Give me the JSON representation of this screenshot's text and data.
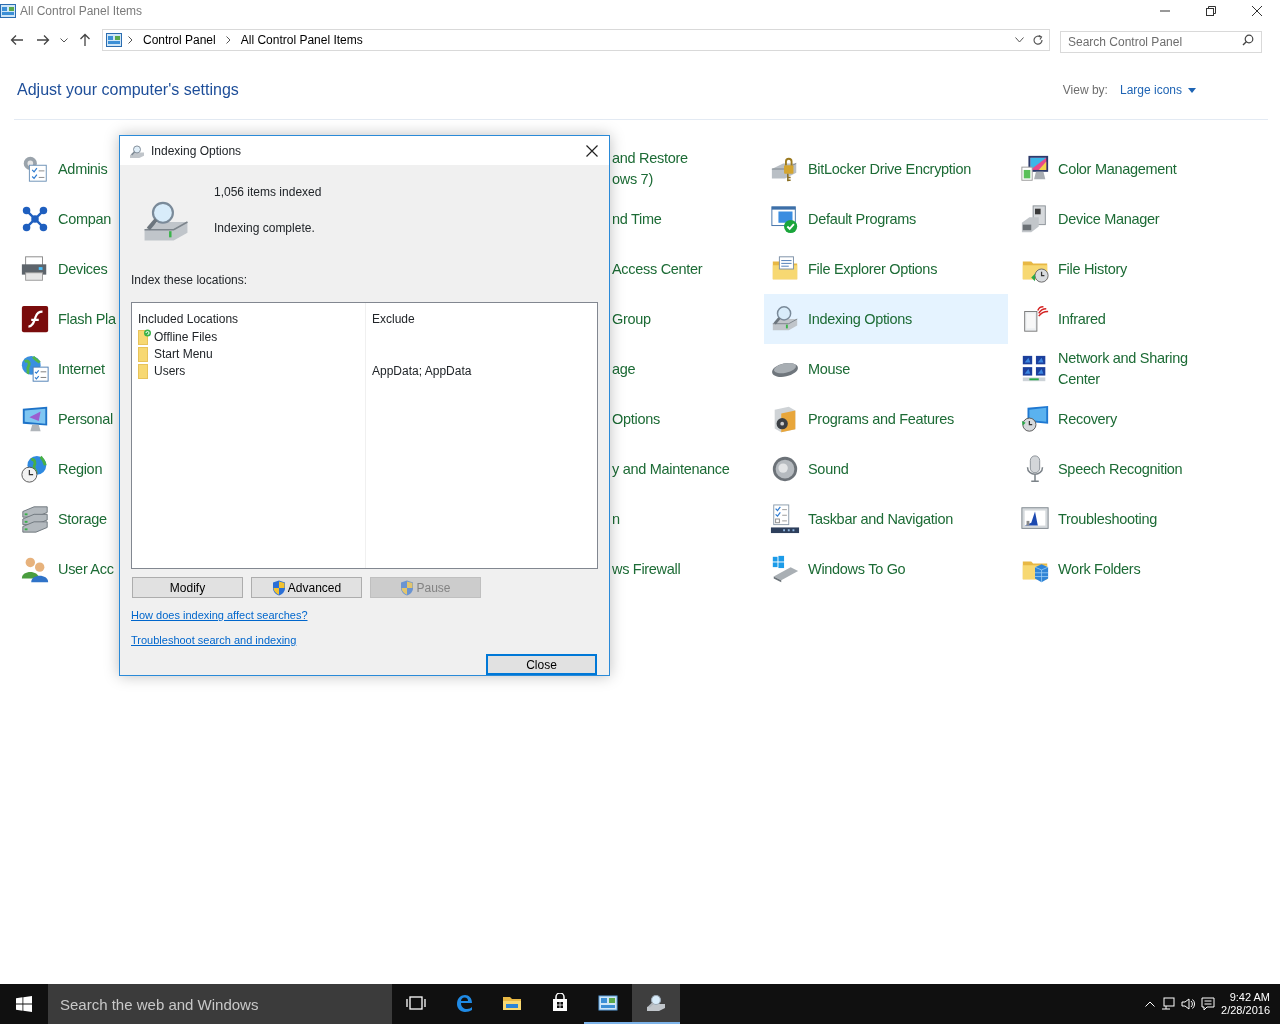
{
  "window": {
    "title": "All Control Panel Items"
  },
  "address_bar": {
    "breadcrumbs": [
      "Control Panel",
      "All Control Panel Items"
    ]
  },
  "search": {
    "placeholder": "Search Control Panel"
  },
  "heading": "Adjust your computer's settings",
  "view_by": {
    "label": "View by:",
    "value": "Large icons"
  },
  "items": [
    {
      "label": "Adminis",
      "kind": "icon",
      "selected": false
    },
    {
      "label": "Compan",
      "kind": "icon",
      "selected": false
    },
    {
      "label": "Devices",
      "kind": "icon",
      "selected": false
    },
    {
      "label": "Flash Pla",
      "kind": "icon",
      "selected": false
    },
    {
      "label": "Internet",
      "kind": "icon",
      "selected": false
    },
    {
      "label": "Personal",
      "kind": "icon",
      "selected": false
    },
    {
      "label": "Region",
      "kind": "icon",
      "selected": false
    },
    {
      "label": "Storage",
      "kind": "icon",
      "selected": false
    },
    {
      "label": "User Acc",
      "kind": "icon",
      "selected": false
    },
    {
      "label": "and Restore\nows 7)",
      "kind": "covered",
      "selected": false
    },
    {
      "label": "nd Time",
      "kind": "covered",
      "selected": false
    },
    {
      "label": "Access Center",
      "kind": "covered",
      "selected": false
    },
    {
      "label": "Group",
      "kind": "covered",
      "selected": false
    },
    {
      "label": "age",
      "kind": "covered",
      "selected": false
    },
    {
      "label": "Options",
      "kind": "covered",
      "selected": false
    },
    {
      "label": "y and Maintenance",
      "kind": "covered",
      "selected": false
    },
    {
      "label": "n",
      "kind": "covered",
      "selected": false
    },
    {
      "label": "ws Firewall",
      "kind": "covered",
      "selected": false
    },
    {
      "label": "BitLocker Drive Encryption",
      "kind": "icon",
      "selected": false
    },
    {
      "label": "Default Programs",
      "kind": "icon",
      "selected": false
    },
    {
      "label": "File Explorer Options",
      "kind": "icon",
      "selected": false
    },
    {
      "label": "Indexing Options",
      "kind": "icon",
      "selected": true
    },
    {
      "label": "Mouse",
      "kind": "icon",
      "selected": false
    },
    {
      "label": "Programs and Features",
      "kind": "icon",
      "selected": false
    },
    {
      "label": "Sound",
      "kind": "icon",
      "selected": false
    },
    {
      "label": "Taskbar and Navigation",
      "kind": "icon",
      "selected": false
    },
    {
      "label": "Windows To Go",
      "kind": "icon",
      "selected": false
    },
    {
      "label": "Color Management",
      "kind": "icon",
      "selected": false
    },
    {
      "label": "Device Manager",
      "kind": "icon",
      "selected": false
    },
    {
      "label": "File History",
      "kind": "icon",
      "selected": false
    },
    {
      "label": "Infrared",
      "kind": "icon",
      "selected": false
    },
    {
      "label": "Network and Sharing Center",
      "kind": "icon",
      "selected": false
    },
    {
      "label": "Recovery",
      "kind": "icon",
      "selected": false
    },
    {
      "label": "Speech Recognition",
      "kind": "icon",
      "selected": false
    },
    {
      "label": "Troubleshooting",
      "kind": "icon",
      "selected": false
    },
    {
      "label": "Work Folders",
      "kind": "icon",
      "selected": false
    }
  ],
  "dialog": {
    "title": "Indexing Options",
    "count": "1,056 items indexed",
    "status": "Indexing complete.",
    "locations_label": "Index these locations:",
    "columns": [
      "Included Locations",
      "Exclude"
    ],
    "rows": [
      {
        "location": "Offline Files",
        "overlay": true
      },
      {
        "location": "Start Menu",
        "overlay": false
      },
      {
        "location": "Users",
        "overlay": false,
        "exclude": "AppData; AppData"
      }
    ],
    "buttons": [
      {
        "label": "Modify",
        "shield": false,
        "disabled": false
      },
      {
        "label": "Advanced",
        "shield": true,
        "disabled": false
      },
      {
        "label": "Pause",
        "shield": true,
        "disabled": true
      }
    ],
    "links": [
      "How does indexing affect searches?",
      "Troubleshoot search and indexing"
    ],
    "close_button": {
      "label": "Close",
      "default": true
    }
  },
  "taskbar": {
    "search": {
      "placeholder": "Search the web and Windows"
    },
    "apps": [
      {
        "kind": "task-view",
        "running": false,
        "selected": false
      },
      {
        "kind": "edge",
        "running": false,
        "selected": false
      },
      {
        "kind": "explorer",
        "running": false,
        "selected": false
      },
      {
        "kind": "store",
        "running": false,
        "selected": false
      },
      {
        "kind": "control-panel",
        "running": true,
        "selected": false
      },
      {
        "kind": "indexing",
        "running": true,
        "selected": true
      }
    ],
    "time": "9:42 AM",
    "date": "2/28/2016"
  }
}
